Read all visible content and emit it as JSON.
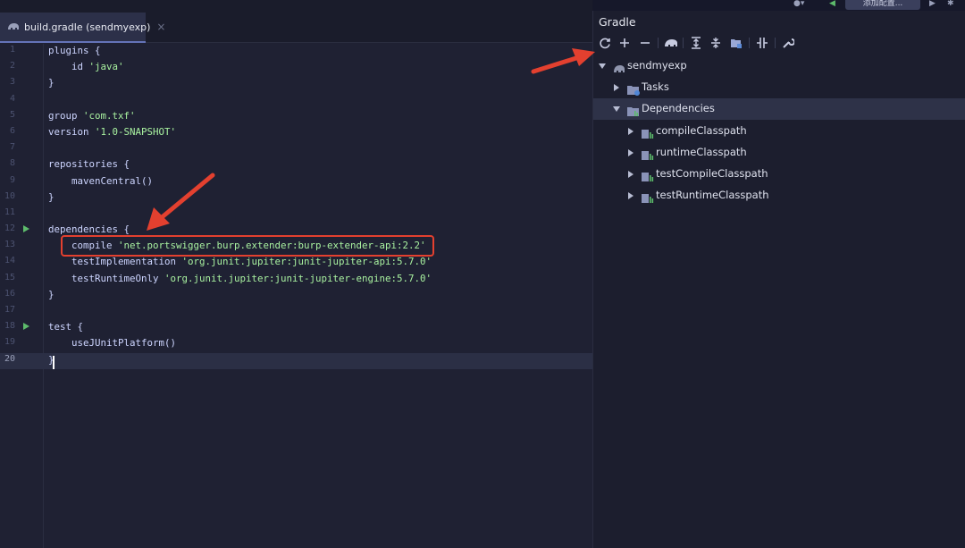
{
  "editor": {
    "tab": {
      "label": "build.gradle (sendmyexp)",
      "close": "×"
    },
    "lines": [
      {
        "n": "1",
        "parts": [
          [
            "p",
            "plugins {"
          ]
        ]
      },
      {
        "n": "2",
        "parts": [
          [
            "p",
            "    id "
          ],
          [
            "s",
            "'java'"
          ]
        ]
      },
      {
        "n": "3",
        "parts": [
          [
            "p",
            "}"
          ]
        ]
      },
      {
        "n": "4",
        "parts": []
      },
      {
        "n": "5",
        "parts": [
          [
            "p",
            "group "
          ],
          [
            "s",
            "'com.txf'"
          ]
        ]
      },
      {
        "n": "6",
        "parts": [
          [
            "p",
            "version "
          ],
          [
            "s",
            "'1.0-SNAPSHOT'"
          ]
        ]
      },
      {
        "n": "7",
        "parts": []
      },
      {
        "n": "8",
        "parts": [
          [
            "p",
            "repositories {"
          ]
        ]
      },
      {
        "n": "9",
        "parts": [
          [
            "p",
            "    mavenCentral()"
          ]
        ]
      },
      {
        "n": "10",
        "parts": [
          [
            "p",
            "}"
          ]
        ]
      },
      {
        "n": "11",
        "parts": []
      },
      {
        "n": "12",
        "parts": [
          [
            "p",
            "dependencies {"
          ]
        ],
        "run": true
      },
      {
        "n": "13",
        "parts": [
          [
            "p",
            "    compile "
          ],
          [
            "s",
            "'net.portswigger.burp.extender:burp-extender-api:2.2'"
          ]
        ]
      },
      {
        "n": "14",
        "parts": [
          [
            "p",
            "    testImplementation "
          ],
          [
            "s",
            "'org.junit.jupiter:junit-jupiter-api:5.7.0'"
          ]
        ]
      },
      {
        "n": "15",
        "parts": [
          [
            "p",
            "    testRuntimeOnly "
          ],
          [
            "s",
            "'org.junit.jupiter:junit-jupiter-engine:5.7.0'"
          ]
        ]
      },
      {
        "n": "16",
        "parts": [
          [
            "p",
            "}"
          ]
        ]
      },
      {
        "n": "17",
        "parts": []
      },
      {
        "n": "18",
        "parts": [
          [
            "p",
            "test {"
          ]
        ],
        "run": true
      },
      {
        "n": "19",
        "parts": [
          [
            "p",
            "    useJUnitPlatform()"
          ]
        ]
      },
      {
        "n": "20",
        "parts": [
          [
            "p",
            "}"
          ]
        ],
        "current": true
      }
    ]
  },
  "gradle": {
    "title": "Gradle",
    "run_config": "添加配置...",
    "toolbar": [
      "reload-icon",
      "plus-icon",
      "minus-icon",
      "elephant-icon",
      "expand-all-icon",
      "collapse-all-icon",
      "dependencies-view-icon",
      "offline-toggle-icon",
      "settings-wrench-icon"
    ],
    "tree": [
      {
        "label": "sendmyexp",
        "depth": 0,
        "expanded": true,
        "icon": "elephant-icon"
      },
      {
        "label": "Tasks",
        "depth": 1,
        "expanded": false,
        "icon": "tasks-folder-icon"
      },
      {
        "label": "Dependencies",
        "depth": 1,
        "expanded": true,
        "selected": true,
        "icon": "dependencies-folder-icon"
      },
      {
        "label": "compileClasspath",
        "depth": 2,
        "expanded": false,
        "icon": "classpath-icon"
      },
      {
        "label": "runtimeClasspath",
        "depth": 2,
        "expanded": false,
        "icon": "classpath-icon"
      },
      {
        "label": "testCompileClasspath",
        "depth": 2,
        "expanded": false,
        "icon": "classpath-icon"
      },
      {
        "label": "testRuntimeClasspath",
        "depth": 2,
        "expanded": false,
        "icon": "classpath-icon"
      }
    ]
  },
  "colors": {
    "annotation": "#e3402f",
    "accent": "#6473b8",
    "run": "#5dbb6b"
  }
}
